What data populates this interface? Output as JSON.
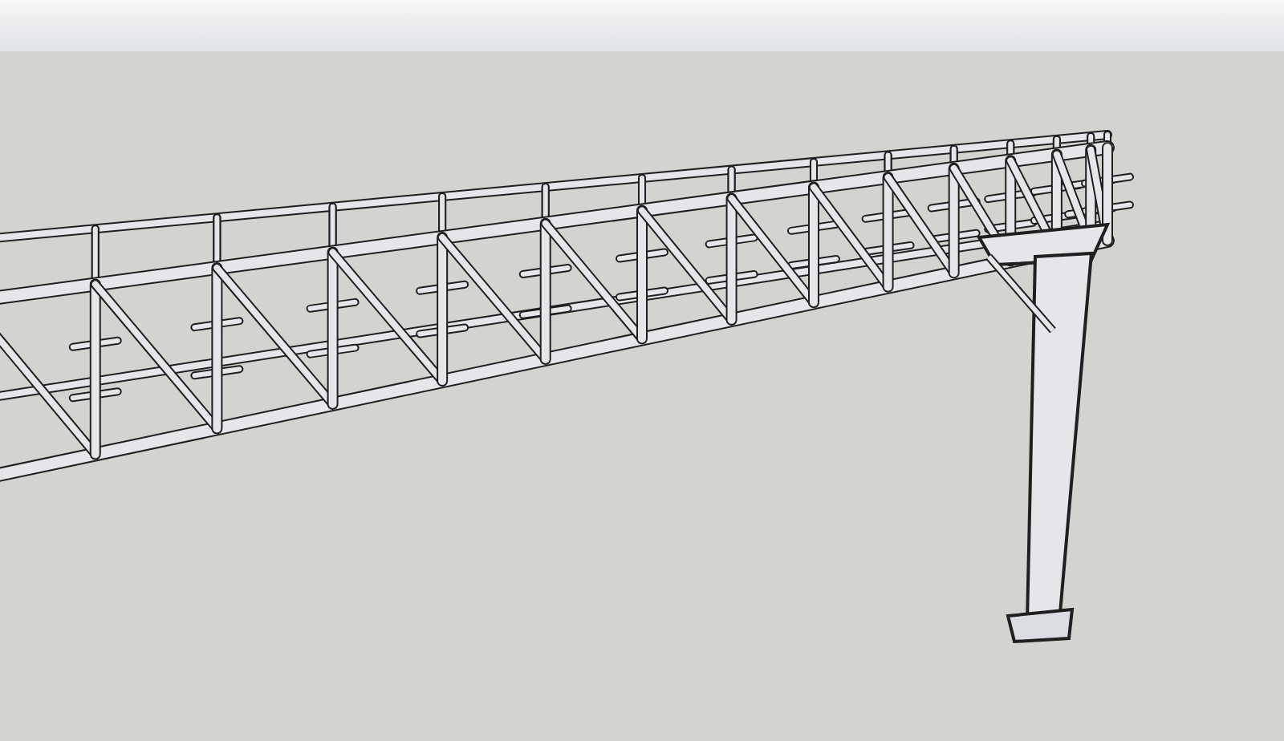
{
  "scene": {
    "kind": "truss"
  }
}
